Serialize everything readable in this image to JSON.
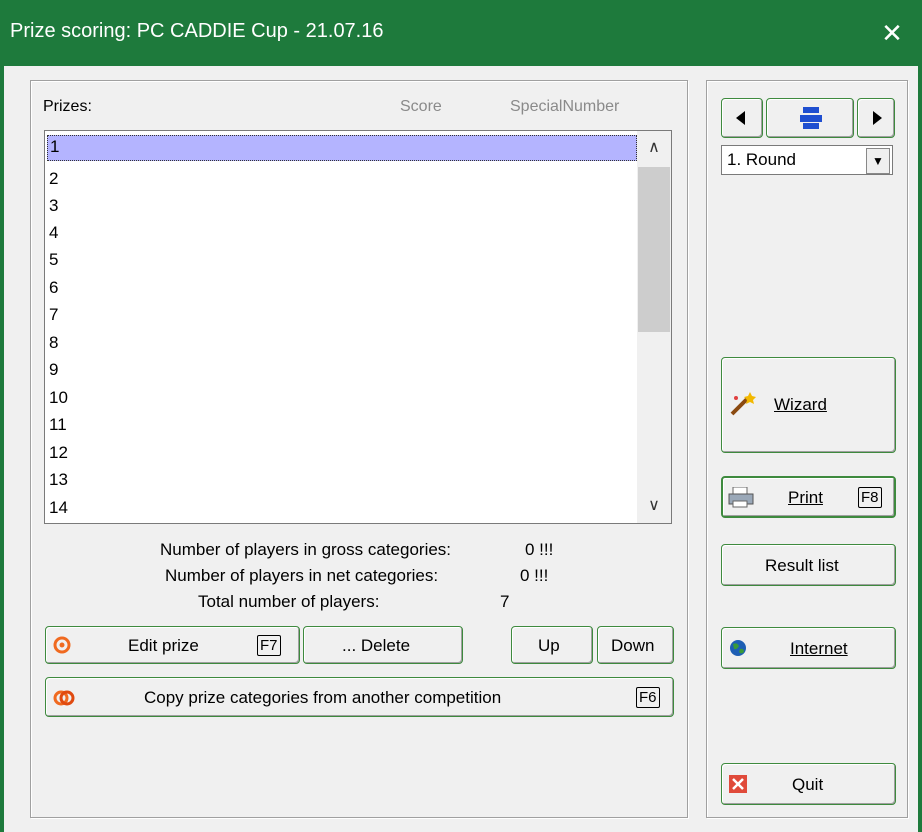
{
  "window": {
    "title": "Prize scoring: PC CADDIE Cup - 21.07.16",
    "close_glyph": "✕",
    "accent": "#1e7a3c"
  },
  "list": {
    "headers": {
      "prizes": "Prizes:",
      "score": "Score",
      "special": "SpecialNumber"
    },
    "rows": [
      "1",
      "2",
      "3",
      "4",
      "5",
      "6",
      "7",
      "8",
      "9",
      "10",
      "11",
      "12",
      "13",
      "14"
    ],
    "selected_index": 0
  },
  "stats": {
    "gross_label": "Number of players in gross categories:",
    "gross_value": "0 !!!",
    "net_label": "Number of players in net categories:",
    "net_value": "0 !!!",
    "total_label": "Total number of players:",
    "total_value": "7"
  },
  "buttons": {
    "edit_prize": "Edit prize",
    "edit_prize_key": "F7",
    "delete": "... Delete",
    "up": "Up",
    "down": "Down",
    "copy_categories": "Copy prize categories from another competition",
    "copy_key": "F6",
    "wizard": "Wizard",
    "print": "Print",
    "print_key": "F8",
    "result_list": "Result list",
    "internet": "Internet",
    "quit": "Quit"
  },
  "round_select": {
    "value": "1. Round"
  },
  "icons": {
    "nav_prev": "arrow-left-icon",
    "nav_print": "printer-icon",
    "nav_next": "arrow-right-icon",
    "edit": "target-icon",
    "copy": "copy-rings-icon",
    "wizard": "magic-wand-icon",
    "print": "printer-icon",
    "internet": "globe-icon",
    "quit": "close-box-icon"
  }
}
